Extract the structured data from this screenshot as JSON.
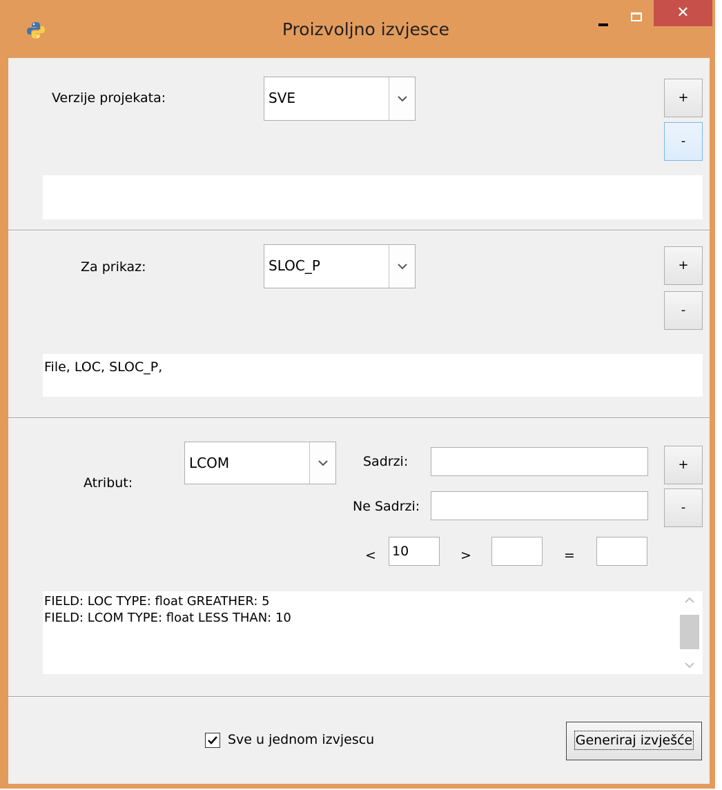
{
  "window": {
    "title": "Proizvoljno izvjesce",
    "close_glyph": "✕",
    "frame_color": "#e39b5c",
    "close_color": "#c7504a"
  },
  "versions": {
    "label": "Verzije projekata:",
    "selected": "SVE",
    "add_label": "+",
    "remove_label": "-",
    "list_text": ""
  },
  "display": {
    "label": "Za prikaz:",
    "selected": "SLOC_P",
    "add_label": "+",
    "remove_label": "-",
    "list_text": "File, LOC, SLOC_P,"
  },
  "filter": {
    "attribute_label": "Atribut:",
    "attribute_selected": "LCOM",
    "contains_label": "Sadrzi:",
    "contains_value": "",
    "not_contains_label": "Ne Sadrzi:",
    "not_contains_value": "",
    "less_label": "<",
    "less_value": "10",
    "greater_label": ">",
    "greater_value": "",
    "equal_label": "=",
    "equal_value": "",
    "add_label": "+",
    "remove_label": "-",
    "conditions": [
      "FIELD: LOC TYPE: float GREATHER: 5",
      "FIELD: LCOM TYPE: float LESS THAN: 10"
    ]
  },
  "footer": {
    "checkbox_label": "Sve u jednom izvjescu",
    "checkbox_checked": true,
    "generate_label": "Generiraj izvješće"
  },
  "icons": {
    "app": "python-icon",
    "dropdown": "chevron-down-icon",
    "check": "checkmark-icon"
  }
}
